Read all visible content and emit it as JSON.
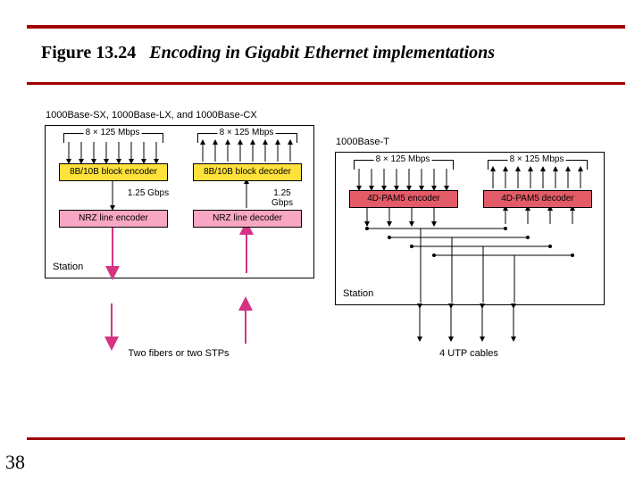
{
  "header": {
    "figure_number": "Figure 13.24",
    "caption": "Encoding in Gigabit Ethernet implementations",
    "page_number": "38"
  },
  "left_panel": {
    "title": "1000Base-SX, 1000Base-LX, and 1000Base-CX",
    "top_rate": "8 × 125 Mbps",
    "mid_rate_left": "1.25 Gbps",
    "mid_rate_right": "1.25 Gbps",
    "encoder": "8B/10B block encoder",
    "decoder": "8B/10B block decoder",
    "line_encoder": "NRZ line encoder",
    "line_decoder": "NRZ line decoder",
    "station": "Station",
    "cables": "Two fibers or two STPs"
  },
  "right_panel": {
    "title": "1000Base-T",
    "top_rate_left": "8 × 125 Mbps",
    "top_rate_right": "8 × 125 Mbps",
    "encoder": "4D-PAM5 encoder",
    "decoder": "4D-PAM5 decoder",
    "station": "Station",
    "cables": "4 UTP cables"
  },
  "chart_data": {
    "type": "diagram",
    "description": "Two block diagrams showing physical-layer encoding stacks for Gigabit Ethernet variants.",
    "panels": [
      {
        "variants": [
          "1000Base-SX",
          "1000Base-LX",
          "1000Base-CX"
        ],
        "input_streams": 8,
        "input_rate_per_stream_mbps": 125,
        "stages": [
          {
            "name": "8B/10B block encoder",
            "role": "encoder",
            "output_rate_gbps": 1.25
          },
          {
            "name": "NRZ line encoder",
            "role": "line_encoder"
          }
        ],
        "reverse_stages": [
          {
            "name": "8B/10B block decoder",
            "role": "decoder",
            "input_rate_gbps": 1.25
          },
          {
            "name": "NRZ line decoder",
            "role": "line_decoder"
          }
        ],
        "medium": "Two fibers or two STPs",
        "medium_count": 2
      },
      {
        "variants": [
          "1000Base-T"
        ],
        "input_streams_tx": 8,
        "input_streams_rx": 8,
        "input_rate_per_stream_mbps": 125,
        "stages": [
          {
            "name": "4D-PAM5 encoder",
            "role": "encoder"
          }
        ],
        "reverse_stages": [
          {
            "name": "4D-PAM5 decoder",
            "role": "decoder"
          }
        ],
        "medium": "4 UTP cables",
        "medium_count": 4,
        "duplex_per_cable": true
      }
    ]
  }
}
